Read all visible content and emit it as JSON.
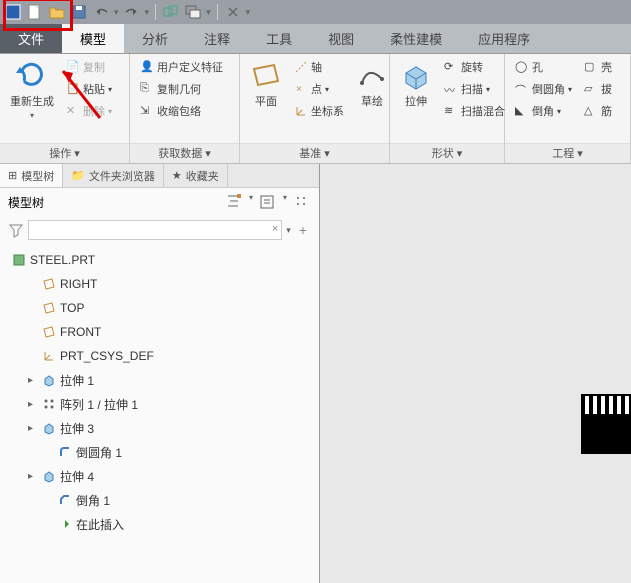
{
  "qat": {
    "icons": [
      "app",
      "new",
      "open",
      "save",
      "undo",
      "redo",
      "sep",
      "regen",
      "regen2",
      "sep",
      "close"
    ]
  },
  "tabs": {
    "file": "文件",
    "items": [
      "模型",
      "分析",
      "注释",
      "工具",
      "视图",
      "柔性建模",
      "应用程序"
    ],
    "active": 0
  },
  "ribbon": {
    "groups": [
      {
        "label": "操作",
        "regen": "重新生成",
        "copy": "复制",
        "paste": "粘贴",
        "delete": "删除"
      },
      {
        "label": "获取数据",
        "udf": "用户定义特征",
        "copygeom": "复制几何",
        "shrink": "收缩包络"
      },
      {
        "label": "基准",
        "plane": "平面",
        "axis": "轴",
        "point": "点",
        "csys": "坐标系",
        "sketch": "草绘"
      },
      {
        "label": "形状",
        "extrude": "拉伸",
        "revolve": "旋转",
        "sweep": "扫描",
        "blend": "扫描混合"
      },
      {
        "label": "工程",
        "hole": "孔",
        "round": "倒圆角",
        "chamfer": "倒角",
        "shell": "壳",
        "draft": "拔",
        "rib": "筋"
      }
    ]
  },
  "treeTabs": {
    "model": "模型树",
    "browser": "文件夹浏览器",
    "fav": "收藏夹"
  },
  "treeHeader": "模型树",
  "filter": {
    "placeholder": ""
  },
  "tree": {
    "root": "STEEL.PRT",
    "items": [
      {
        "label": "RIGHT",
        "icon": "plane",
        "lvl": 1
      },
      {
        "label": "TOP",
        "icon": "plane",
        "lvl": 1
      },
      {
        "label": "FRONT",
        "icon": "plane",
        "lvl": 1
      },
      {
        "label": "PRT_CSYS_DEF",
        "icon": "csys",
        "lvl": 1
      },
      {
        "label": "拉伸 1",
        "icon": "extrude",
        "lvl": 1,
        "exp": true
      },
      {
        "label": "阵列 1 / 拉伸 1",
        "icon": "pattern",
        "lvl": 1,
        "exp": true
      },
      {
        "label": "拉伸 3",
        "icon": "extrude",
        "lvl": 1,
        "exp": true
      },
      {
        "label": "倒圆角 1",
        "icon": "round",
        "lvl": 2
      },
      {
        "label": "拉伸 4",
        "icon": "extrude",
        "lvl": 1,
        "exp": true
      },
      {
        "label": "倒角 1",
        "icon": "chamfer",
        "lvl": 2
      },
      {
        "label": "在此插入",
        "icon": "insert",
        "lvl": 2
      }
    ]
  }
}
